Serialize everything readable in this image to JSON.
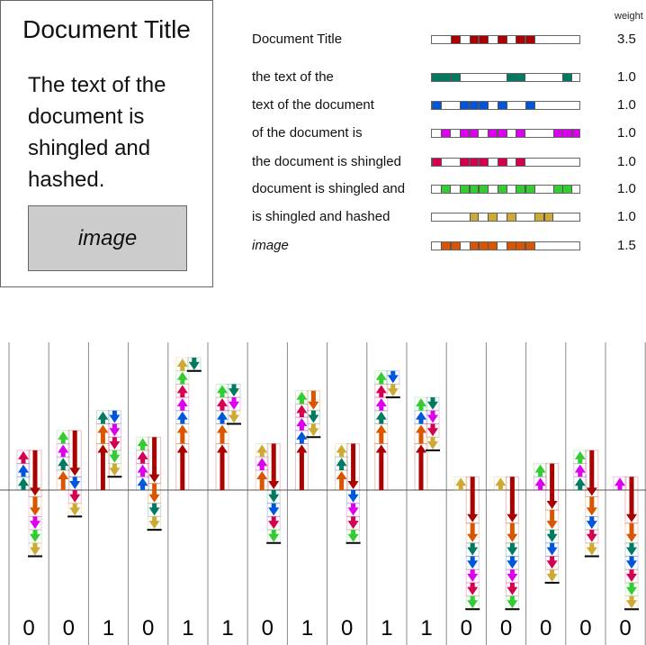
{
  "document": {
    "title": "Document Title",
    "body": "The text of the document is shingled and hashed.",
    "image_label": "image"
  },
  "weights_header": "weight",
  "colors": {
    "title": "#aa0000",
    "s1": "#007a60",
    "s2": "#0055dd",
    "s3": "#dd00ee",
    "s4": "#d4004f",
    "s5": "#33cc33",
    "s6": "#ccaa33",
    "image": "#d95500"
  },
  "shingles": [
    {
      "label": "Document Title",
      "italic": false,
      "weight": "3.5",
      "color_key": "title",
      "bits": [
        0,
        0,
        1,
        0,
        1,
        1,
        0,
        1,
        0,
        1,
        1,
        0,
        0,
        0,
        0,
        0
      ]
    },
    {
      "label": "the text of the",
      "italic": false,
      "weight": "1.0",
      "color_key": "s1",
      "bits": [
        1,
        1,
        1,
        0,
        0,
        0,
        0,
        0,
        1,
        1,
        0,
        0,
        0,
        0,
        1,
        0
      ]
    },
    {
      "label": "text of the document",
      "italic": false,
      "weight": "1.0",
      "color_key": "s2",
      "bits": [
        1,
        0,
        0,
        1,
        1,
        1,
        0,
        1,
        0,
        0,
        1,
        0,
        0,
        0,
        0,
        0
      ]
    },
    {
      "label": "of the document is",
      "italic": false,
      "weight": "1.0",
      "color_key": "s3",
      "bits": [
        0,
        1,
        0,
        1,
        1,
        0,
        1,
        1,
        0,
        1,
        0,
        0,
        0,
        1,
        1,
        1
      ]
    },
    {
      "label": "the document is shingled",
      "italic": false,
      "weight": "1.0",
      "color_key": "s4",
      "bits": [
        1,
        0,
        0,
        1,
        1,
        1,
        0,
        1,
        0,
        1,
        0,
        0,
        0,
        0,
        0,
        0
      ]
    },
    {
      "label": "document is shingled and",
      "italic": false,
      "weight": "1.0",
      "color_key": "s5",
      "bits": [
        0,
        1,
        0,
        1,
        1,
        1,
        0,
        1,
        0,
        1,
        1,
        0,
        0,
        1,
        1,
        0
      ]
    },
    {
      "label": "is shingled and hashed",
      "italic": false,
      "weight": "1.0",
      "color_key": "s6",
      "bits": [
        0,
        0,
        0,
        0,
        1,
        0,
        1,
        0,
        1,
        0,
        0,
        1,
        1,
        0,
        0,
        0
      ]
    },
    {
      "label": "image",
      "italic": true,
      "weight": "1.5",
      "color_key": "image",
      "bits": [
        0,
        1,
        1,
        0,
        1,
        1,
        1,
        0,
        1,
        1,
        1,
        0,
        0,
        0,
        0,
        0
      ]
    }
  ],
  "simhash_bits": [
    "0",
    "0",
    "1",
    "0",
    "1",
    "1",
    "0",
    "1",
    "0",
    "1",
    "1",
    "0",
    "0",
    "0",
    "0",
    "0"
  ]
}
